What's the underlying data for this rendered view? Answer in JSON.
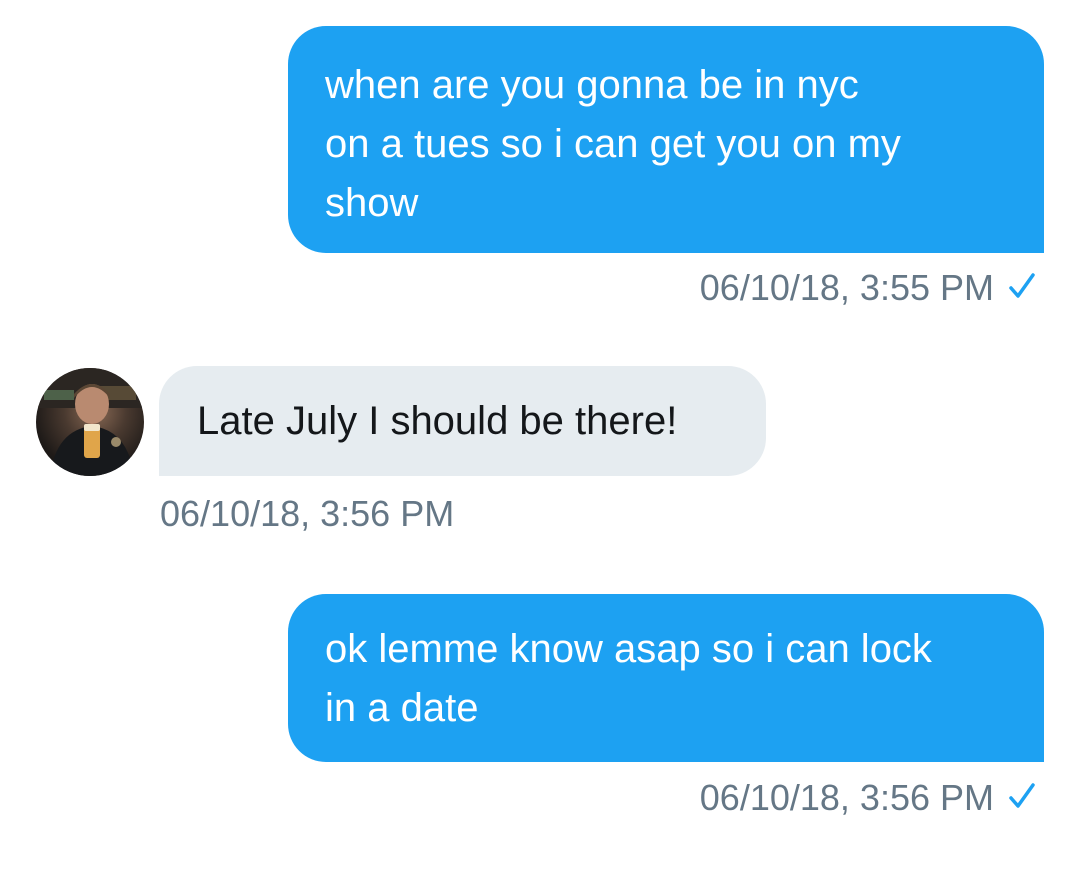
{
  "conversation": {
    "messages": [
      {
        "direction": "sent",
        "text": "when are you gonna be in nyc\non a tues so i can get you on my\nshow",
        "timestamp": "06/10/18, 3:55 PM",
        "read_icon": "checkmark-icon"
      },
      {
        "direction": "received",
        "text": "Late July I should be there!",
        "timestamp": "06/10/18, 3:56 PM",
        "avatar_icon": "avatar"
      },
      {
        "direction": "sent",
        "text": "ok lemme know asap so i can lock\nin a date",
        "timestamp": "06/10/18, 3:56 PM",
        "read_icon": "checkmark-icon"
      }
    ]
  },
  "colors": {
    "sent_bubble": "#1da1f2",
    "received_bubble": "#e6ecf0",
    "timestamp_text": "#657786",
    "checkmark": "#1da1f2"
  }
}
